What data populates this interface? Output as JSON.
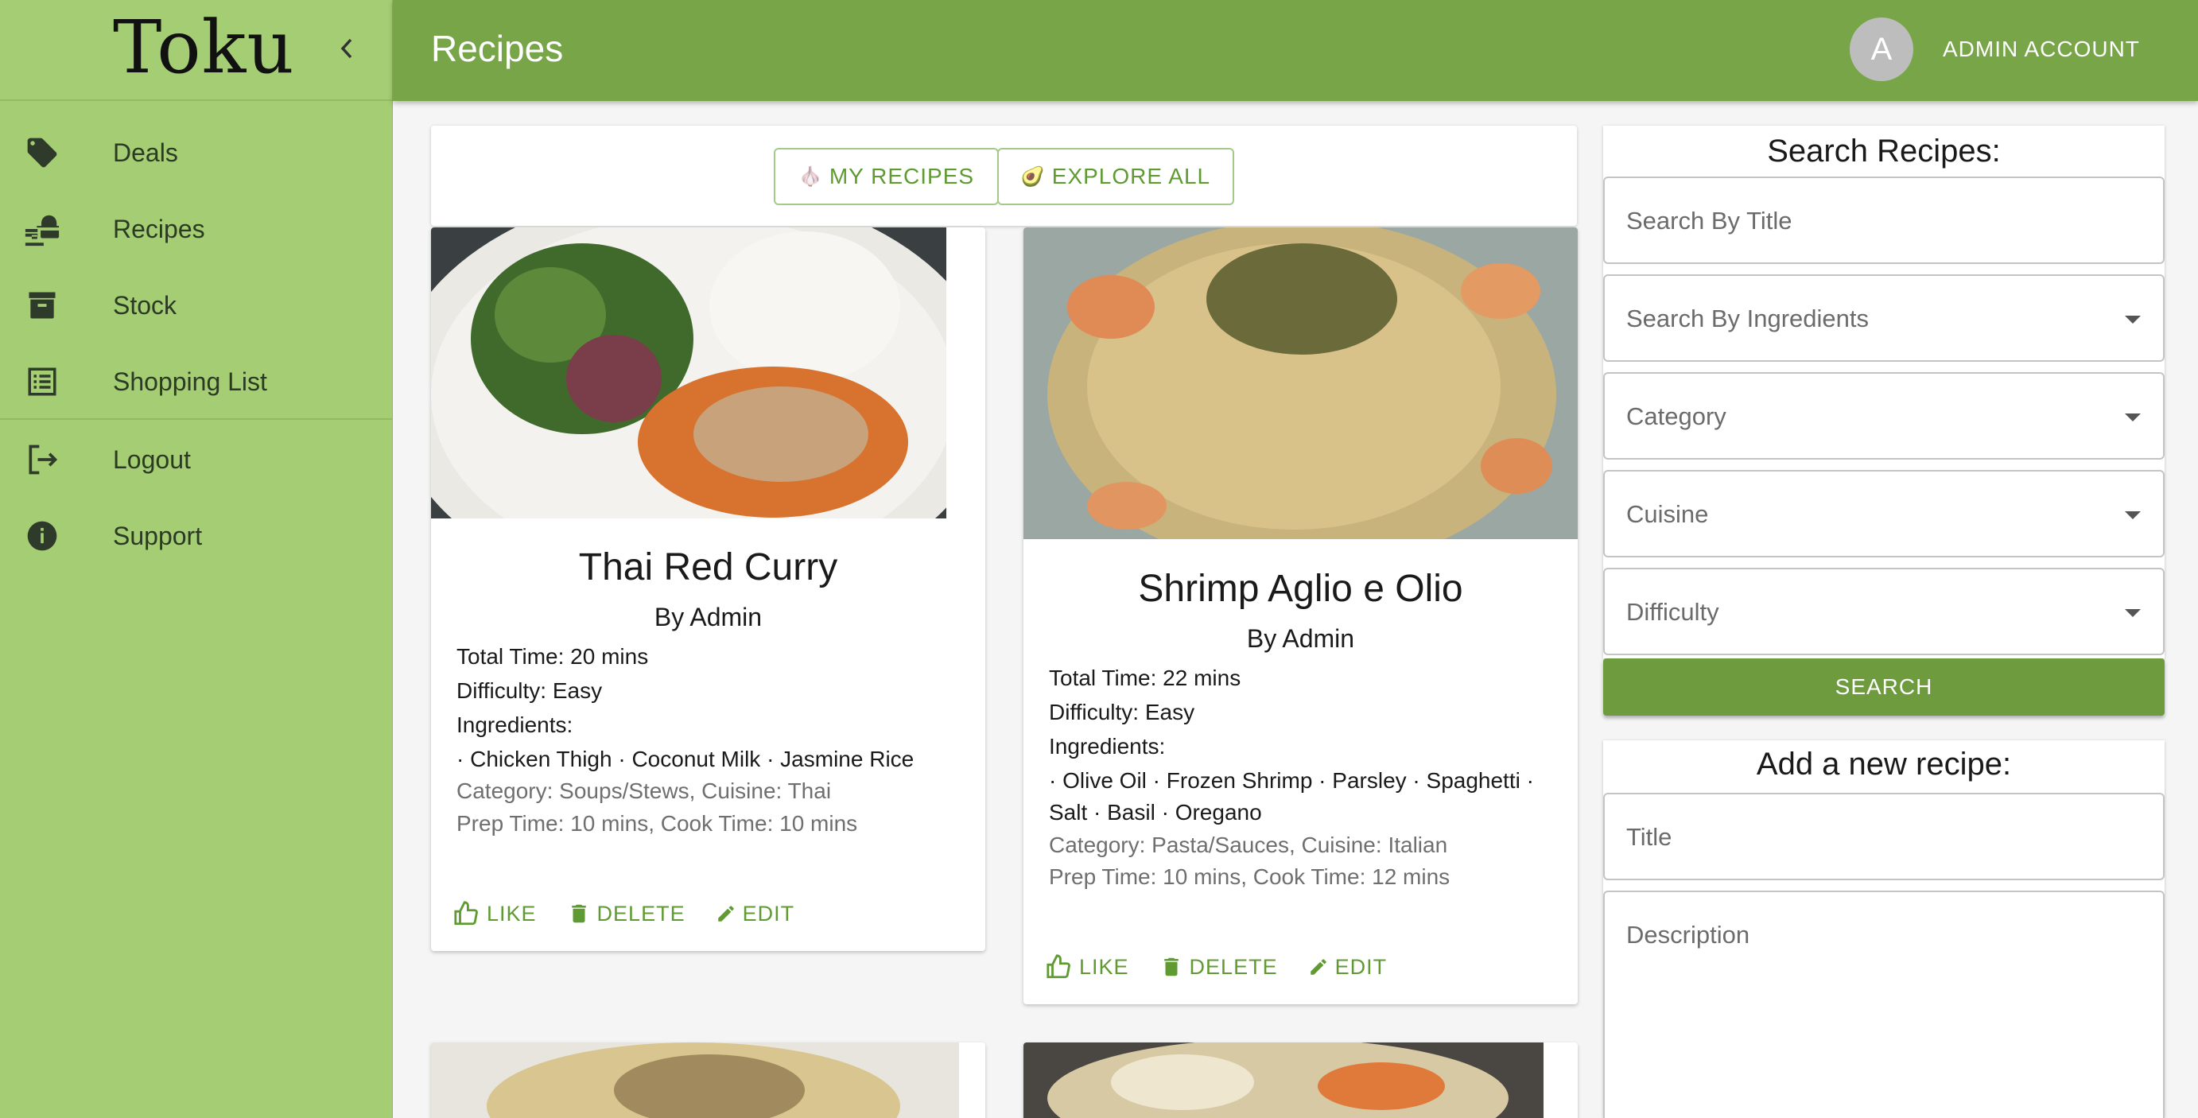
{
  "sidebar": {
    "logo": "Toku",
    "items": [
      {
        "label": "Deals",
        "icon": "tag-icon"
      },
      {
        "label": "Recipes",
        "icon": "food-service-icon"
      },
      {
        "label": "Stock",
        "icon": "archive-box-icon"
      },
      {
        "label": "Shopping List",
        "icon": "list-icon"
      },
      {
        "label": "Logout",
        "icon": "logout-icon"
      },
      {
        "label": "Support",
        "icon": "info-icon"
      }
    ]
  },
  "header": {
    "title": "Recipes",
    "avatar_letter": "A",
    "account_label": "ADMIN ACCOUNT"
  },
  "tabs": {
    "my_recipes": {
      "emoji": "🧄",
      "label": "MY RECIPES"
    },
    "explore_all": {
      "emoji": "🥑",
      "label": "EXPLORE ALL"
    }
  },
  "recipes": [
    {
      "title": "Thai Red Curry",
      "author": "By Admin",
      "total_time": "Total Time: 20 mins",
      "difficulty": "Difficulty: Easy",
      "ingredients_label": "Ingredients:",
      "ingredients_line1": "· Chicken Thigh · Coconut Milk · Jasmine Rice",
      "category": "Category: Soups/Stews, Cuisine: Thai",
      "prep": "Prep Time: 10 mins, Cook Time: 10 mins"
    },
    {
      "title": "Shrimp Aglio e Olio",
      "author": "By Admin",
      "total_time": "Total Time: 22 mins",
      "difficulty": "Difficulty: Easy",
      "ingredients_label": "Ingredients:",
      "ingredients_line1": "· Olive Oil · Frozen Shrimp · Parsley · Spaghetti ·",
      "ingredients_line2": "Salt · Basil · Oregano",
      "category": "Category: Pasta/Sauces, Cuisine: Italian",
      "prep": "Prep Time: 10 mins, Cook Time: 12 mins"
    }
  ],
  "actions": {
    "like": "LIKE",
    "delete": "DELETE",
    "edit": "EDIT"
  },
  "search": {
    "heading": "Search Recipes:",
    "title_placeholder": "Search By Title",
    "ingredients_placeholder": "Search By Ingredients",
    "category_placeholder": "Category",
    "cuisine_placeholder": "Cuisine",
    "difficulty_placeholder": "Difficulty",
    "button": "SEARCH"
  },
  "add_recipe": {
    "heading": "Add a new recipe:",
    "title_placeholder": "Title",
    "description_placeholder": "Description"
  },
  "colors": {
    "sidebar": "#a5cd74",
    "appbar": "#77a548",
    "accent": "#5f9a32",
    "button": "#6d9b3e"
  }
}
